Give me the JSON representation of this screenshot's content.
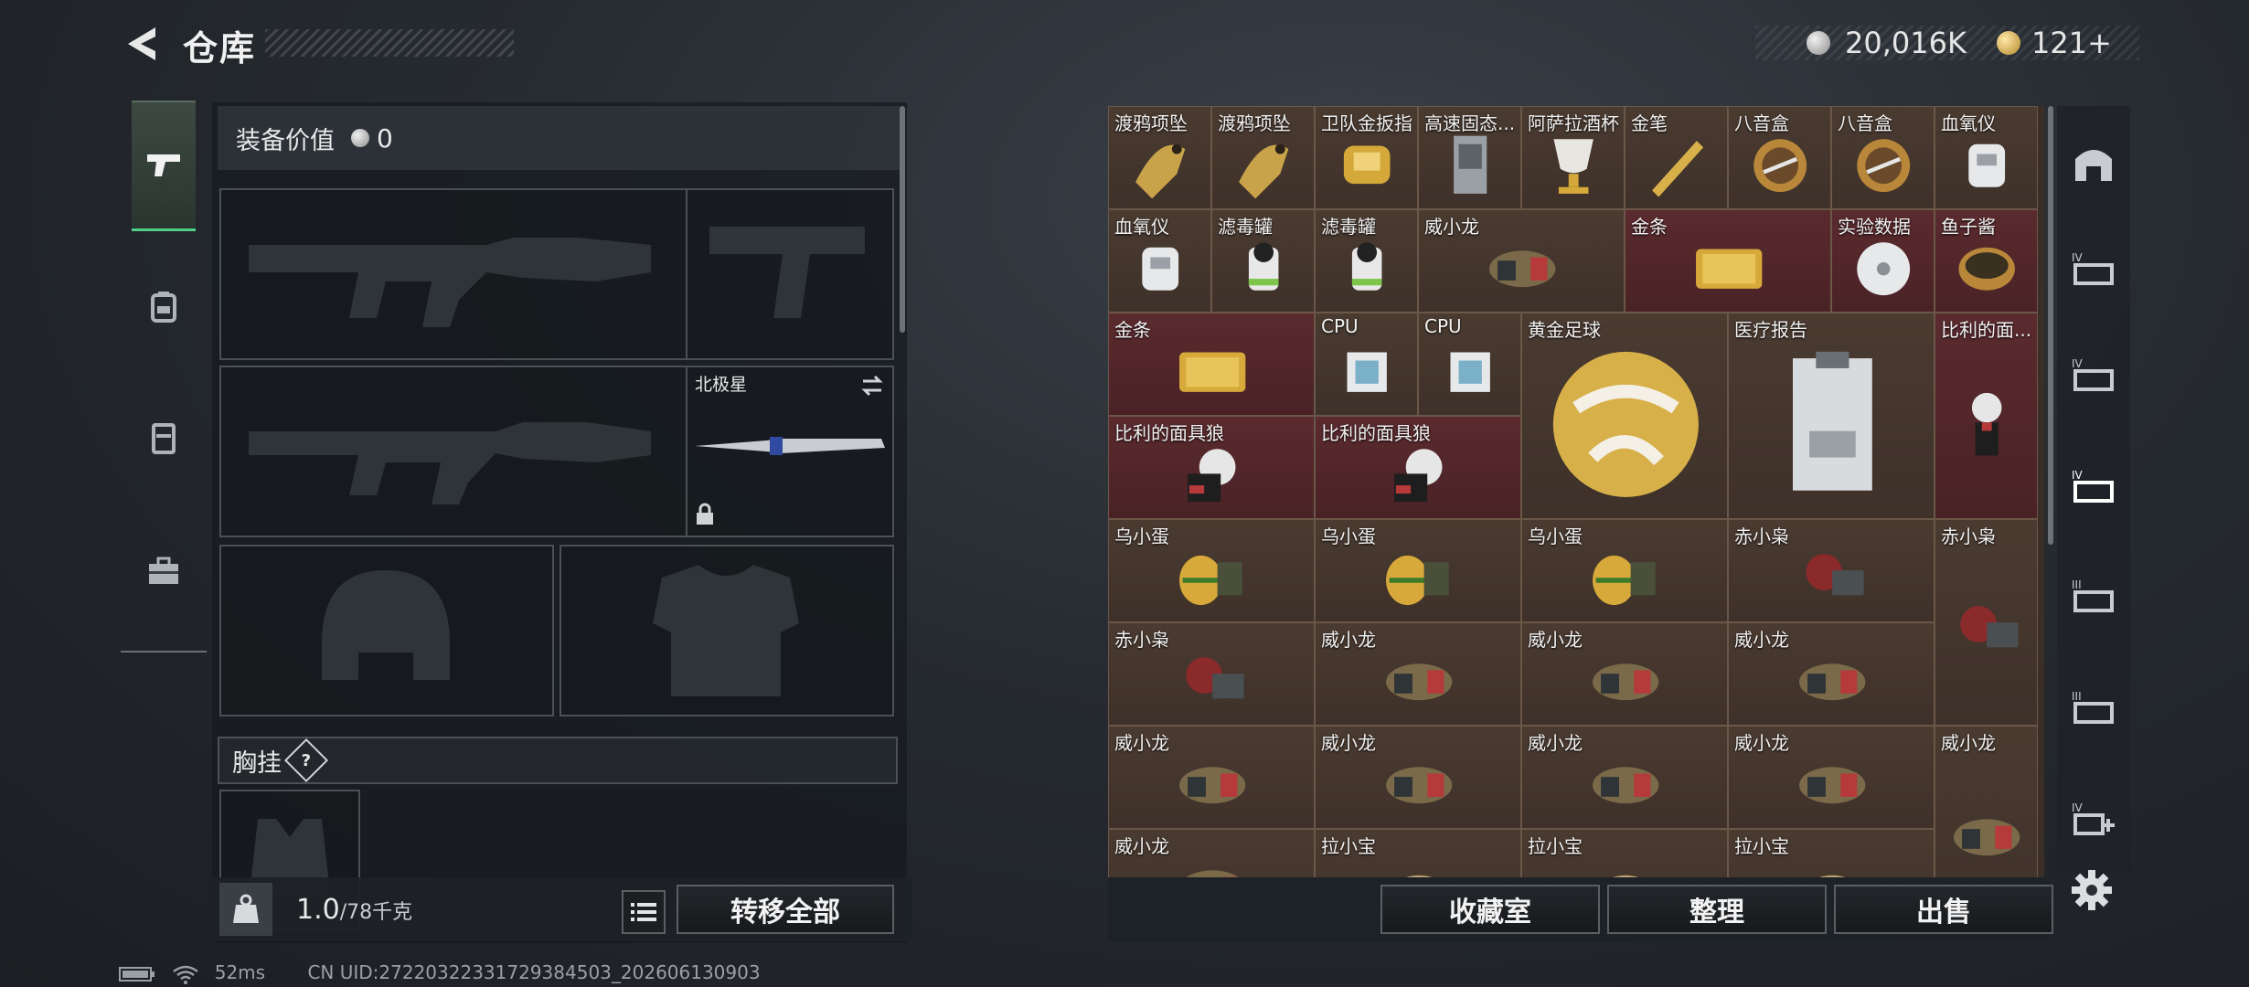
{
  "header": {
    "title": "仓库"
  },
  "currency": {
    "silver": "20,016K",
    "gold": "121+"
  },
  "left_nav": {
    "tabs": [
      {
        "icon": "pistol-icon",
        "active": true
      },
      {
        "icon": "backpack-icon",
        "active": false
      },
      {
        "icon": "vest-icon",
        "active": false
      },
      {
        "icon": "toolbox-icon",
        "active": false
      }
    ]
  },
  "equipment": {
    "value_label": "装备价值",
    "value": "0",
    "melee_name": "北极星",
    "chest_rig_label": "胸挂",
    "chest_rig_help": "?"
  },
  "capacity": {
    "current": "1.0",
    "max": "/78千克"
  },
  "buttons": {
    "transfer_all": "转移全部",
    "collection": "收藏室",
    "sort": "整理",
    "sell": "出售"
  },
  "grid_items": [
    {
      "label": "渡鸦项坠",
      "bg": "brown",
      "icon": "raven-pendant"
    },
    {
      "label": "渡鸦项坠",
      "bg": "brown",
      "icon": "raven-pendant"
    },
    {
      "label": "卫队金扳指",
      "bg": "brown",
      "icon": "gold-ring"
    },
    {
      "label": "高速固态...",
      "bg": "brown",
      "icon": "ssd"
    },
    {
      "label": "阿萨拉酒杯",
      "bg": "brown",
      "icon": "goblet"
    },
    {
      "label": "金笔",
      "bg": "brown",
      "icon": "gold-pen"
    },
    {
      "label": "八音盒",
      "bg": "brown",
      "icon": "music-box"
    },
    {
      "label": "八音盒",
      "bg": "brown",
      "icon": "music-box"
    },
    {
      "label": "血氧仪",
      "bg": "brown",
      "icon": "oximeter"
    },
    {
      "label": "血氧仪",
      "bg": "brown",
      "icon": "oximeter"
    },
    {
      "label": "滤毒罐",
      "bg": "brown",
      "icon": "filter-canister"
    },
    {
      "label": "滤毒罐",
      "bg": "brown",
      "icon": "filter-canister"
    },
    {
      "label": "威小龙",
      "bg": "brown",
      "icon": "dragon-figure"
    },
    {
      "label": "金条",
      "bg": "red",
      "icon": "gold-bar"
    },
    {
      "label": "实验数据",
      "bg": "red",
      "icon": "disc"
    },
    {
      "label": "鱼子酱",
      "bg": "red",
      "icon": "caviar"
    },
    {
      "label": "金条",
      "bg": "red",
      "icon": "gold-bar"
    },
    {
      "label": "CPU",
      "bg": "brown",
      "icon": "cpu"
    },
    {
      "label": "CPU",
      "bg": "brown",
      "icon": "cpu"
    },
    {
      "label": "黄金足球",
      "bg": "brown",
      "icon": "gold-football"
    },
    {
      "label": "医疗报告",
      "bg": "brown",
      "icon": "medical-report"
    },
    {
      "label": "比利的面...",
      "bg": "red",
      "icon": "billy-mask"
    },
    {
      "label": "比利的面具狼",
      "bg": "red",
      "icon": "billy-puppet"
    },
    {
      "label": "比利的面具狼",
      "bg": "red",
      "icon": "billy-puppet"
    },
    {
      "label": "乌小蛋",
      "bg": "brown",
      "icon": "egg-figure"
    },
    {
      "label": "乌小蛋",
      "bg": "brown",
      "icon": "egg-figure"
    },
    {
      "label": "乌小蛋",
      "bg": "brown",
      "icon": "egg-figure"
    },
    {
      "label": "赤小枭",
      "bg": "brown",
      "icon": "owl-figure"
    },
    {
      "label": "赤小枭",
      "bg": "brown",
      "icon": "owl-figure"
    },
    {
      "label": "赤小枭",
      "bg": "brown",
      "icon": "owl-figure"
    },
    {
      "label": "威小龙",
      "bg": "brown",
      "icon": "dragon-figure"
    },
    {
      "label": "威小龙",
      "bg": "brown",
      "icon": "dragon-figure"
    },
    {
      "label": "威小龙",
      "bg": "brown",
      "icon": "dragon-figure"
    },
    {
      "label": "威小龙",
      "bg": "brown",
      "icon": "dragon-figure"
    },
    {
      "label": "威小龙",
      "bg": "brown",
      "icon": "dragon-figure"
    },
    {
      "label": "威小龙",
      "bg": "brown",
      "icon": "dragon-figure"
    },
    {
      "label": "威小龙",
      "bg": "brown",
      "icon": "dragon-figure"
    },
    {
      "label": "威小龙",
      "bg": "brown",
      "icon": "dragon-figure"
    },
    {
      "label": "威小龙",
      "bg": "brown",
      "icon": "dragon-figure"
    },
    {
      "label": "威小龙",
      "bg": "brown",
      "icon": "dragon-figure"
    },
    {
      "label": "拉小宝",
      "bg": "brown",
      "icon": "lion-figure"
    },
    {
      "label": "拉小宝",
      "bg": "brown",
      "icon": "lion-figure"
    },
    {
      "label": "拉小宝",
      "bg": "brown",
      "icon": "lion-figure"
    }
  ],
  "status_bar": {
    "ping": "52ms",
    "uid": "CN UID:27220322331729384503_202606130903"
  },
  "colors": {
    "accent_green": "#4fd08a",
    "cell_brown": "#4a3b31",
    "cell_red": "#5a2a2e"
  }
}
